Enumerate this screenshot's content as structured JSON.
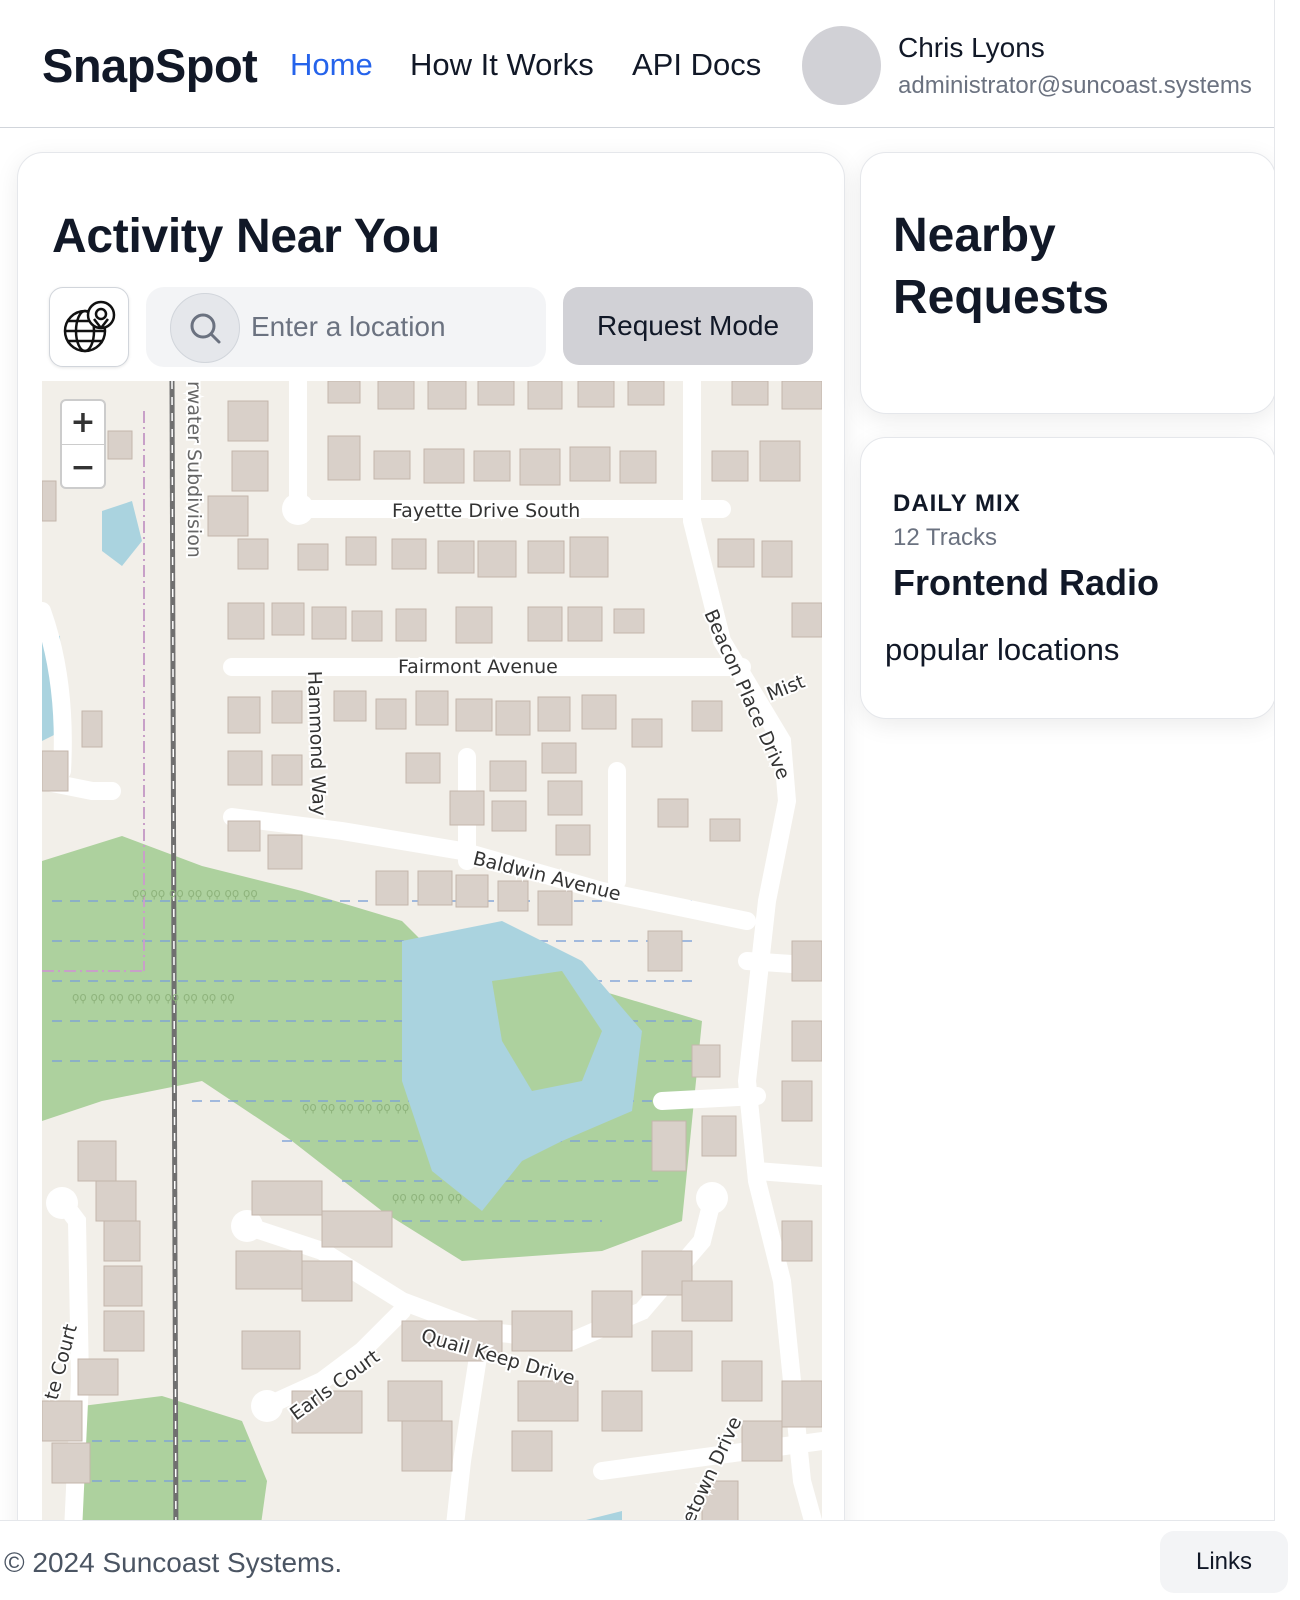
{
  "header": {
    "brand": "SnapSpot",
    "nav": [
      {
        "label": "Home",
        "active": true
      },
      {
        "label": "How It Works",
        "active": false
      },
      {
        "label": "API Docs",
        "active": false
      }
    ],
    "user": {
      "name": "Chris Lyons",
      "email": "administrator@suncoast.systems"
    }
  },
  "main": {
    "title": "Activity Near You",
    "search": {
      "placeholder": "Enter a location",
      "value": ""
    },
    "request_mode_label": "Request Mode",
    "map": {
      "zoom_in": "+",
      "zoom_out": "−",
      "street_labels": {
        "fayette": "Fayette Drive South",
        "fairmont": "Fairmont Avenue",
        "hammond": "Hammond Way",
        "baldwin": "Baldwin Avenue",
        "beacon": "Beacon Place Drive",
        "mist": "Mist",
        "quail": "Quail Keep Drive",
        "earls": "Earls Court",
        "georgetown": "orgetown Drive",
        "court": "te Court",
        "subdivision": "rwater Subdivision"
      }
    }
  },
  "sidebar": {
    "nearby": {
      "title": "Nearby Requests"
    },
    "mix": {
      "label": "DAILY MIX",
      "tracks": "12 Tracks",
      "title": "Frontend Radio",
      "description": "popular locations"
    }
  },
  "footer": {
    "copyright": "© 2024 Suncoast Systems.",
    "links_label": "Links"
  },
  "colors": {
    "accent": "#2563eb",
    "map_land": "#f2efe9",
    "map_building": "#d9d0c9",
    "map_water": "#aad3df",
    "map_wetland": "#add19e"
  },
  "icons": [
    "globe-pin-icon",
    "search-icon",
    "zoom-in-icon",
    "zoom-out-icon"
  ]
}
